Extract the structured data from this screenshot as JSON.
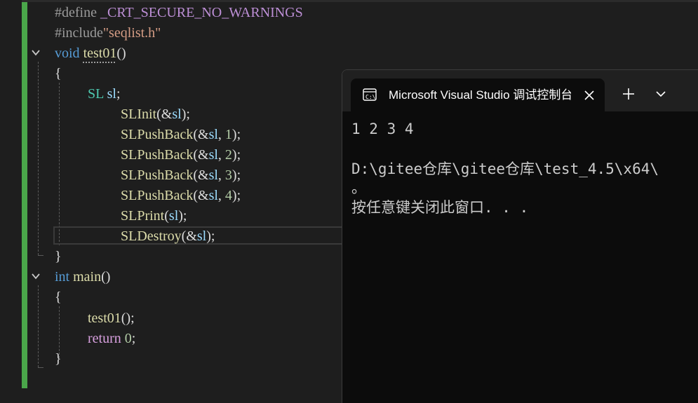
{
  "editor": {
    "lines": {
      "l1": {
        "pre": "#define",
        "macro": "_CRT_SECURE_NO_WARNINGS"
      },
      "l2": {
        "pre": "#include",
        "str": "\"seqlist.h\""
      },
      "l3": {
        "kw": "void",
        "fn": "test01",
        "punc": "()"
      },
      "l4": {
        "punc": "{"
      },
      "l5": {
        "type": "SL",
        "var": "sl",
        "punc": ";"
      },
      "l6": {
        "fn": "SLInit",
        "open": "(&",
        "var": "sl",
        "close": ");"
      },
      "l7": {
        "fn": "SLPushBack",
        "open": "(&",
        "var": "sl",
        "sep": ", ",
        "num": "1",
        "close": ");"
      },
      "l8": {
        "fn": "SLPushBack",
        "open": "(&",
        "var": "sl",
        "sep": ", ",
        "num": "2",
        "close": ");"
      },
      "l9": {
        "fn": "SLPushBack",
        "open": "(&",
        "var": "sl",
        "sep": ", ",
        "num": "3",
        "close": ");"
      },
      "l10": {
        "fn": "SLPushBack",
        "open": "(&",
        "var": "sl",
        "sep": ", ",
        "num": "4",
        "close": ");"
      },
      "l11": {
        "fn": "SLPrint",
        "open": "(",
        "var": "sl",
        "close": ");"
      },
      "l12": {
        "fn": "SLDestroy",
        "open": "(&",
        "var": "sl",
        "close": ");"
      },
      "l13": {
        "punc": "}"
      },
      "l14": {
        "kw": "int",
        "fn": "main",
        "punc": "()"
      },
      "l15": {
        "punc": "{"
      },
      "l16": {
        "fn": "test01",
        "punc": "();"
      },
      "l17": {
        "kw": "return",
        "num": "0",
        "punc": ";"
      },
      "l18": {
        "punc": "}"
      }
    }
  },
  "terminal": {
    "tab_title": "Microsoft Visual Studio 调试控制台",
    "tab_icon": "console-icon",
    "close_icon": "close-icon",
    "new_tab_icon": "plus-icon",
    "dropdown_icon": "chevron-down-icon",
    "output": {
      "line1": "1 2 3 4",
      "line2": "D:\\gitee仓库\\gitee仓库\\test_4.5\\x64\\",
      "line3": "。",
      "line4": "按任意键关闭此窗口. . ."
    }
  },
  "colors": {
    "change_bar": "#4aa64a",
    "keyword": "#569cd6",
    "function": "#dcdcaa",
    "type": "#4ec9b0",
    "variable": "#9cdcfe",
    "number": "#b5cea8",
    "string": "#d69d85",
    "macro": "#bd8fd6"
  }
}
